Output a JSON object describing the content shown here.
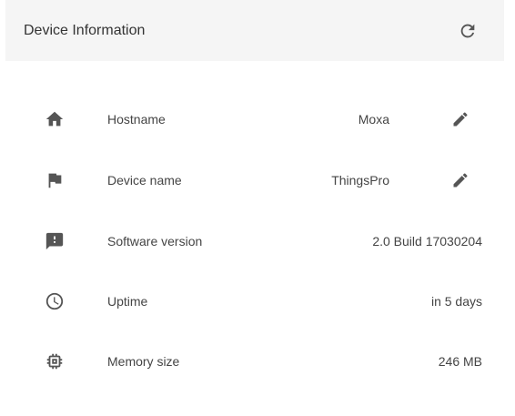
{
  "header": {
    "title": "Device Information",
    "refresh_icon": "refresh-icon"
  },
  "rows": [
    {
      "icon": "home-icon",
      "label": "Hostname",
      "value": "Moxa",
      "editable": true
    },
    {
      "icon": "flag-icon",
      "label": "Device name",
      "value": "ThingsPro",
      "editable": true
    },
    {
      "icon": "feedback-icon",
      "label": "Software version",
      "value": "2.0 Build 17030204",
      "editable": false
    },
    {
      "icon": "clock-icon",
      "label": "Uptime",
      "value": "in 5 days",
      "editable": false
    },
    {
      "icon": "memory-chip-icon",
      "label": "Memory size",
      "value": "246 MB",
      "editable": false
    }
  ],
  "colors": {
    "header_bg": "#f5f5f5",
    "icon": "#555555",
    "text": "#444444"
  }
}
